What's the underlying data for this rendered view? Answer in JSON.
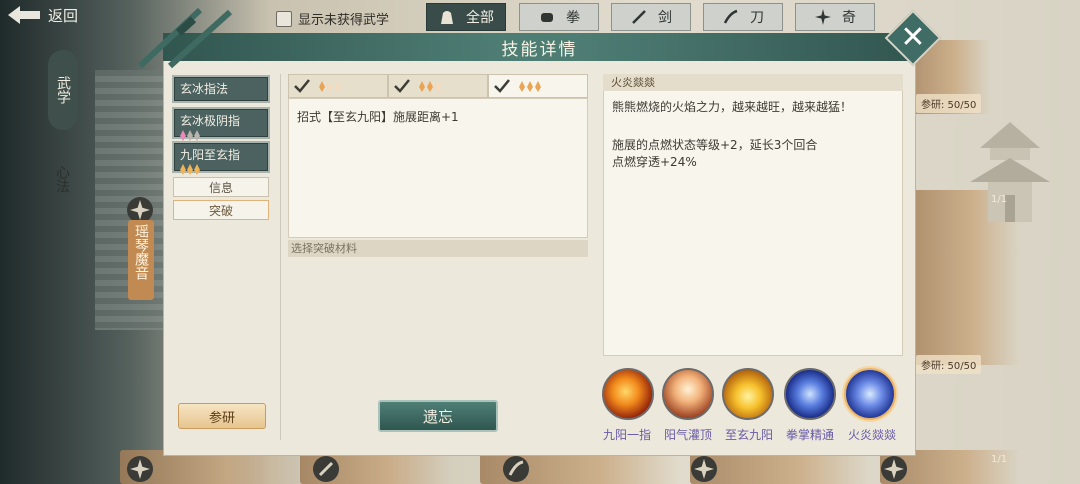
{
  "topbar": {
    "back_label": "返回",
    "filter_label": "显示未获得武学",
    "tabs": [
      {
        "label": "全部",
        "icon": "bag-icon"
      },
      {
        "label": "拳",
        "icon": "fist-icon"
      },
      {
        "label": "剑",
        "icon": "sword-icon"
      },
      {
        "label": "刀",
        "icon": "blade-icon"
      },
      {
        "label": "奇",
        "icon": "shuriken-icon"
      }
    ]
  },
  "left_rail": {
    "wuxue": "武学",
    "xinfa": "心法",
    "skill": "瑶琴魔音"
  },
  "background": {
    "research_top": "参研: 50/50",
    "research_bottom": "参研: 50/50",
    "count_a": "1/1",
    "count_b": "1/1"
  },
  "dialog": {
    "title": "技能详情",
    "skills": [
      "玄冰指法",
      "玄冰极阴指",
      "九阳至玄指"
    ],
    "side_tabs": [
      "信息",
      "突破"
    ],
    "research_button": "参研",
    "breakthrough_desc": "招式【至玄九阳】施展距离+1",
    "material_label": "选择突破材料",
    "forget_button": "遗忘",
    "effect_title": "火炎燚燚",
    "effect_lines": [
      "熊熊燃烧的火焰之力，越来越旺，越来越猛！",
      "施展的点燃状态等级+2，延长3个回合",
      "点燃穿透+24%"
    ],
    "sub_skills": [
      "九阳一指",
      "阳气灌顶",
      "至玄九阳",
      "拳掌精通",
      "火炎燚燚"
    ]
  },
  "colors": {
    "header_teal": "#4e7d74",
    "accent_gold": "#e9b46a",
    "skill_label_purple": "#6a5aa8"
  }
}
